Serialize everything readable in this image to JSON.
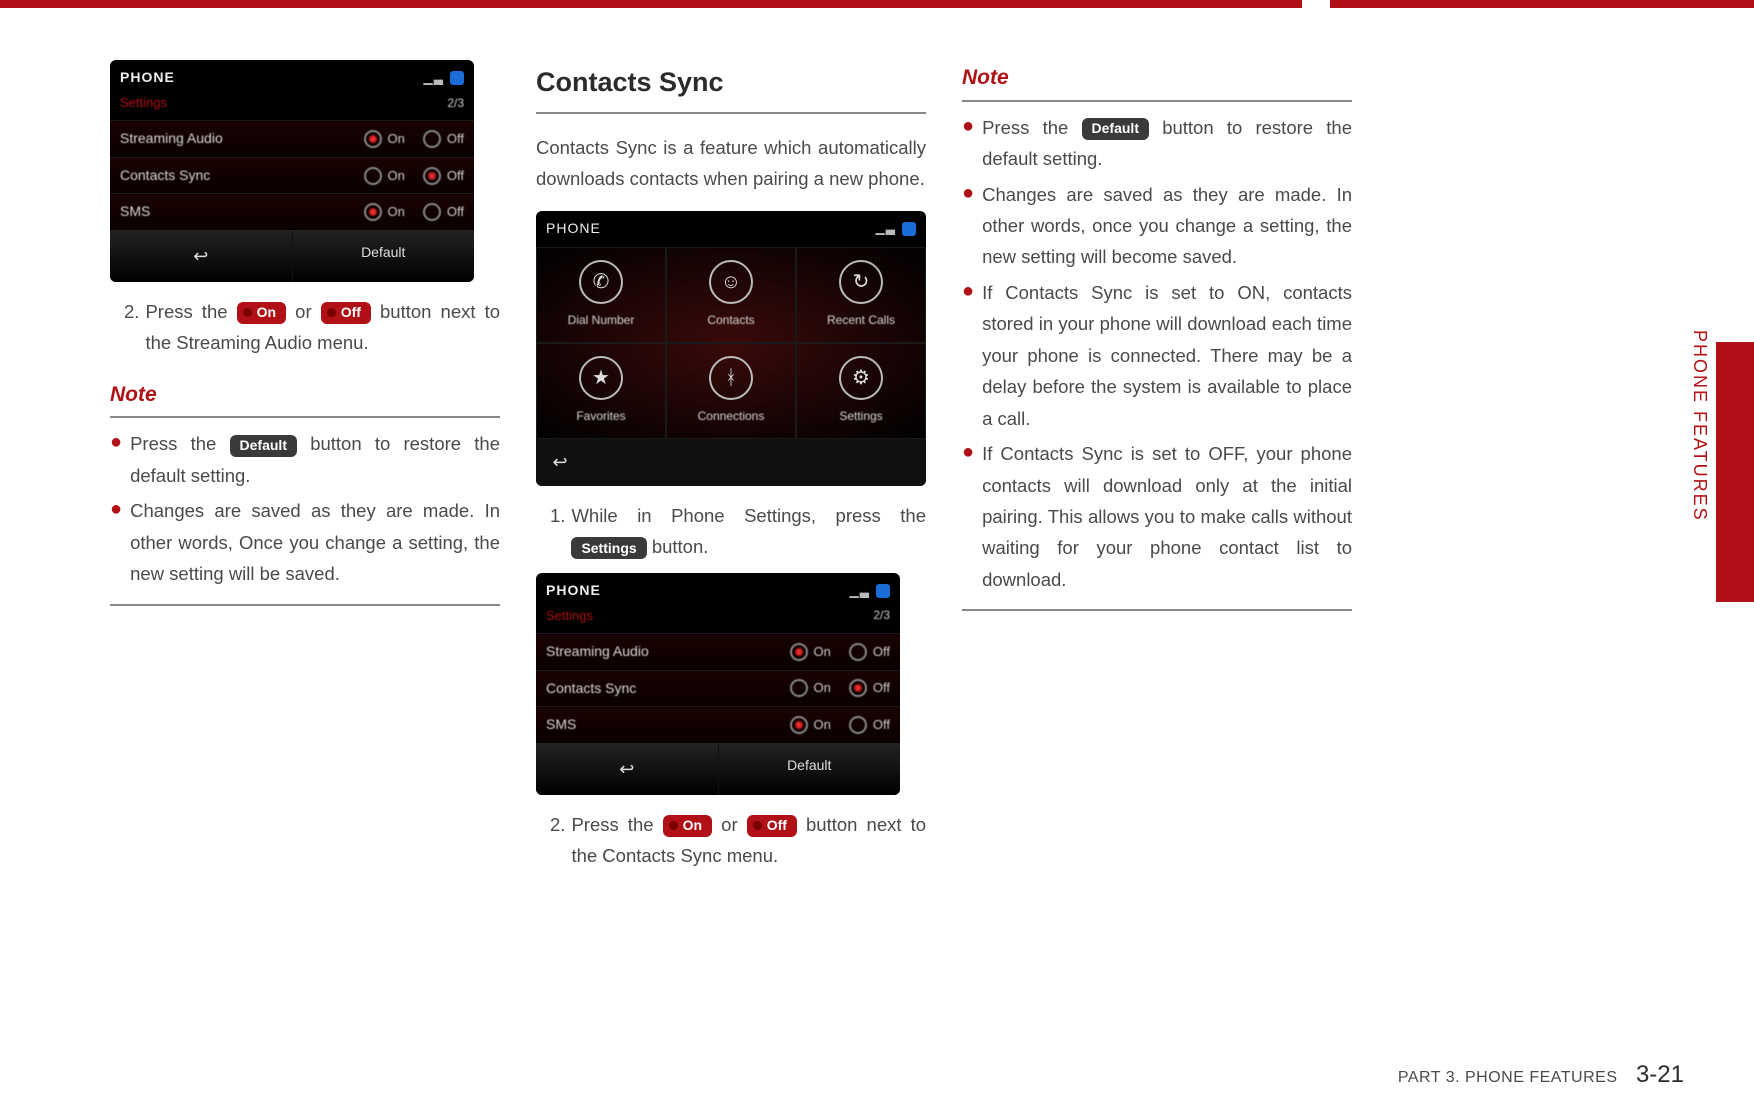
{
  "section_tab": "PHONE FEATURES",
  "footer": {
    "label": "PART 3. PHONE FEATURES",
    "page": "3-21"
  },
  "badges": {
    "on": "On",
    "off": "Off",
    "default": "Default",
    "settings": "Settings"
  },
  "col1": {
    "shot": {
      "header": "PHONE",
      "sub": "Settings",
      "page_indicator": "2/3",
      "rows": [
        {
          "label": "Streaming Audio",
          "on": "On",
          "off": "Off",
          "selected": "on"
        },
        {
          "label": "Contacts Sync",
          "on": "On",
          "off": "Off",
          "selected": "off"
        },
        {
          "label": "SMS",
          "on": "On",
          "off": "Off",
          "selected": "on"
        }
      ],
      "footer_back": "↩",
      "footer_default": "Default"
    },
    "step2_num": "2.",
    "step2_a": "Press the ",
    "step2_b": " or ",
    "step2_c": " button next to the Streaming Audio menu.",
    "note_title": "Note",
    "note_items": [
      {
        "pre": "Press the ",
        "badge": "default",
        "post": " button to restore the default setting."
      },
      {
        "text": "Changes are saved as they are made. In other words, Once you change a setting, the new setting will be saved."
      }
    ]
  },
  "col2": {
    "title": "Contacts Sync",
    "intro": "Contacts Sync is a feature which automatically downloads contacts when pairing a new phone.",
    "grid_shot": {
      "header": "PHONE",
      "cells": [
        {
          "icon": "phone",
          "label": "Dial Number"
        },
        {
          "icon": "person",
          "label": "Contacts"
        },
        {
          "icon": "recent",
          "label": "Recent Calls"
        },
        {
          "icon": "star",
          "label": "Favorites"
        },
        {
          "icon": "bt",
          "label": "Connections"
        },
        {
          "icon": "gear",
          "label": "Settings"
        }
      ],
      "footer_back": "↩"
    },
    "step1_num": "1.",
    "step1_a": "While in Phone Settings, press the ",
    "step1_b": " button.",
    "shot": {
      "header": "PHONE",
      "sub": "Settings",
      "page_indicator": "2/3",
      "rows": [
        {
          "label": "Streaming Audio",
          "on": "On",
          "off": "Off",
          "selected": "on"
        },
        {
          "label": "Contacts Sync",
          "on": "On",
          "off": "Off",
          "selected": "off"
        },
        {
          "label": "SMS",
          "on": "On",
          "off": "Off",
          "selected": "on"
        }
      ],
      "footer_back": "↩",
      "footer_default": "Default"
    },
    "step2_num": "2.",
    "step2_a": "Press the ",
    "step2_b": " or ",
    "step2_c": " button next to the Contacts Sync menu."
  },
  "col3": {
    "note_title": "Note",
    "item1_pre": "Press the ",
    "item1_post": " button to restore the default setting.",
    "item2": "Changes are saved as they are made. In other words, once you change a setting, the new setting will become saved.",
    "item3": "If Contacts Sync is set to ON, contacts stored in your phone will download each time your phone is connected. There may be a delay before the system is available to place a call.",
    "item4": "If Contacts Sync is set to OFF, your phone contacts will download only at the initial pairing. This allows you to make calls without waiting for your phone contact list to download."
  }
}
